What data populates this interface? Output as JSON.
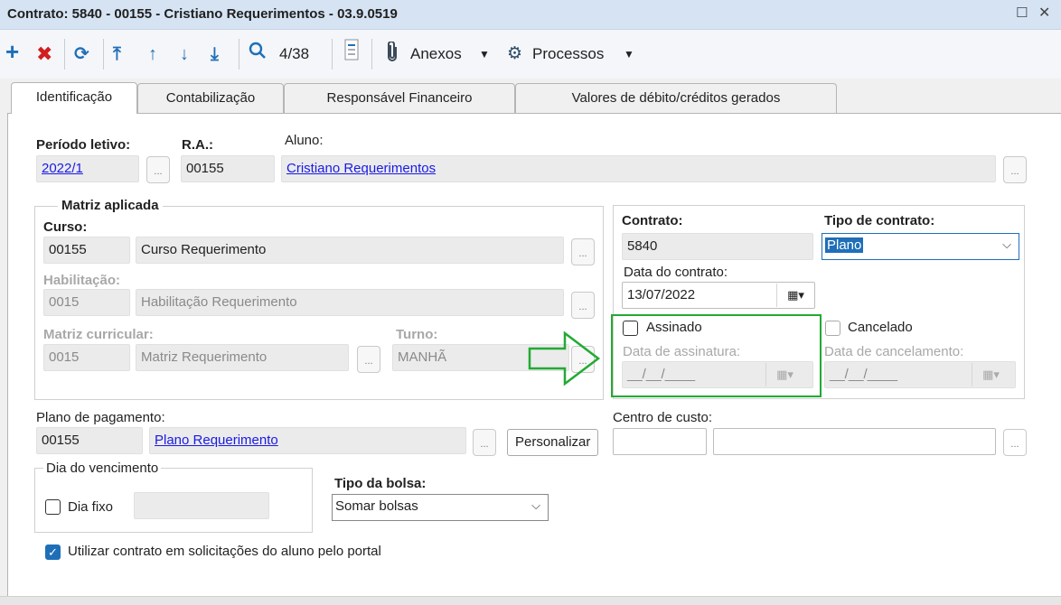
{
  "window": {
    "title": "Contrato: 5840 - 00155 - Cristiano Requerimentos - 03.9.0519"
  },
  "toolbar": {
    "counter": "4/38",
    "attachments": "Anexos",
    "processes": "Processos",
    "icons": [
      "plus-icon",
      "delete-icon",
      "refresh-icon",
      "first-icon",
      "previous-icon",
      "next-icon",
      "last-icon",
      "search-icon",
      "list-icon",
      "paperclip-icon",
      "gear-icon"
    ]
  },
  "tabs": [
    {
      "label": "Identificação",
      "active": true
    },
    {
      "label": "Contabilização"
    },
    {
      "label": "Responsável Financeiro"
    },
    {
      "label": "Valores de débito/créditos gerados"
    }
  ],
  "form": {
    "periodo_label": "Período letivo:",
    "periodo_value": "2022/1",
    "ra_label": "R.A.:",
    "ra_value": "00155",
    "aluno_label": "Aluno:",
    "aluno_value": "Cristiano Requerimentos",
    "matriz_title": "Matriz aplicada",
    "curso_label": "Curso:",
    "curso_code": "00155",
    "curso_name": "Curso Requerimento",
    "habilitacao_label": "Habilitação:",
    "habilitacao_code": "0015",
    "habilitacao_name": "Habilitação Requerimento",
    "matriz_curricular_label": "Matriz curricular:",
    "matriz_code": "0015",
    "matriz_name": "Matriz Requerimento",
    "turno_label": "Turno:",
    "turno_value": "MANHÃ",
    "contrato_label": "Contrato:",
    "contrato_value": "5840",
    "tipo_contrato_label": "Tipo de contrato:",
    "tipo_contrato_value": "Plano",
    "data_contrato_label": "Data do contrato:",
    "data_contrato_value": "13/07/2022",
    "assinado_label": "Assinado",
    "cancelado_label": "Cancelado",
    "data_assinatura_label": "Data de assinatura:",
    "data_assinatura_value": "__/__/____",
    "data_cancelamento_label": "Data de cancelamento:",
    "data_cancelamento_value": "__/__/____",
    "plano_label": "Plano de pagamento:",
    "plano_code": "00155",
    "plano_name": "Plano Requerimento",
    "personalizar": "Personalizar",
    "centro_label": "Centro de custo:",
    "dia_vencimento_title": "Dia do vencimento",
    "dia_fixo_label": "Dia fixo",
    "tipo_bolsa_label": "Tipo da bolsa:",
    "tipo_bolsa_value": "Somar bolsas",
    "portal_label": "Utilizar contrato em solicitações do aluno pelo portal",
    "portal_checked": true
  },
  "colors": {
    "highlight": "#22aa33",
    "link": "#1a1ae6",
    "accent": "#1f6fb8"
  }
}
